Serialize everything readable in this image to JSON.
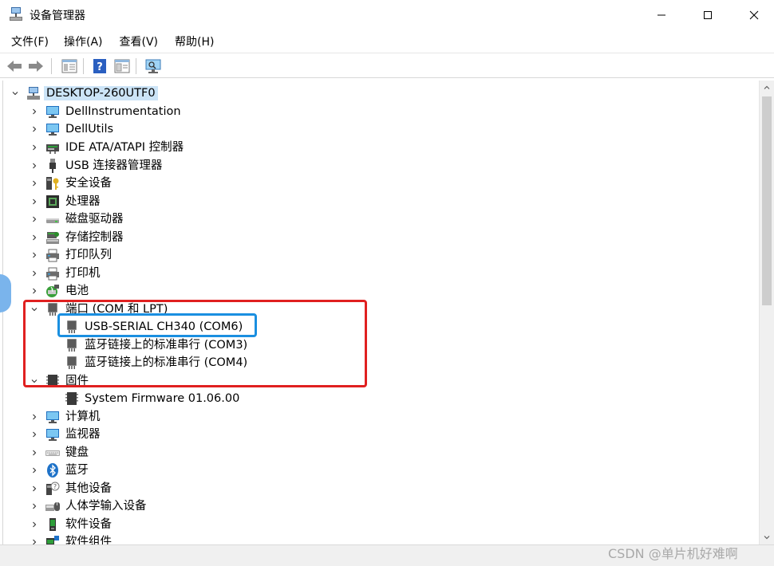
{
  "window": {
    "title": "设备管理器",
    "controls": {
      "minimize": "–",
      "maximize": "□",
      "close": "✕"
    }
  },
  "menu": {
    "items": [
      {
        "label": "文件(F)"
      },
      {
        "label": "操作(A)"
      },
      {
        "label": "查看(V)"
      },
      {
        "label": "帮助(H)"
      }
    ]
  },
  "toolbar": {
    "buttons": [
      "back-arrow-icon",
      "forward-arrow-icon",
      "properties-icon",
      "help-icon",
      "view-panel-icon",
      "monitor-scan-icon"
    ]
  },
  "tree": {
    "root": {
      "label": "DESKTOP-260UTF0"
    },
    "categories": [
      {
        "label": "DellInstrumentation",
        "icon": "monitor-icon",
        "expanded": false
      },
      {
        "label": "DellUtils",
        "icon": "monitor-icon",
        "expanded": false
      },
      {
        "label": "IDE ATA/ATAPI 控制器",
        "icon": "ide-controller-icon",
        "expanded": false
      },
      {
        "label": "USB 连接器管理器",
        "icon": "usb-plug-icon",
        "expanded": false
      },
      {
        "label": "安全设备",
        "icon": "security-key-icon",
        "expanded": false
      },
      {
        "label": "处理器",
        "icon": "processor-chip-icon",
        "expanded": false
      },
      {
        "label": "磁盘驱动器",
        "icon": "disk-drive-icon",
        "expanded": false
      },
      {
        "label": "存储控制器",
        "icon": "storage-controller-icon",
        "expanded": false
      },
      {
        "label": "打印队列",
        "icon": "printer-icon",
        "expanded": false
      },
      {
        "label": "打印机",
        "icon": "printer-icon",
        "expanded": false
      },
      {
        "label": "电池",
        "icon": "battery-icon",
        "expanded": false
      },
      {
        "label": "端口 (COM 和 LPT)",
        "icon": "port-connector-icon",
        "expanded": true,
        "children": [
          {
            "label": "USB-SERIAL CH340 (COM6)",
            "icon": "port-connector-icon"
          },
          {
            "label": "蓝牙链接上的标准串行 (COM3)",
            "icon": "port-connector-icon"
          },
          {
            "label": "蓝牙链接上的标准串行 (COM4)",
            "icon": "port-connector-icon"
          }
        ]
      },
      {
        "label": "固件",
        "icon": "firmware-chip-icon",
        "expanded": true,
        "children": [
          {
            "label": "System Firmware 01.06.00",
            "icon": "firmware-chip-icon"
          }
        ]
      },
      {
        "label": "计算机",
        "icon": "monitor-icon",
        "expanded": false
      },
      {
        "label": "监视器",
        "icon": "monitor-icon",
        "expanded": false
      },
      {
        "label": "键盘",
        "icon": "keyboard-icon",
        "expanded": false
      },
      {
        "label": "蓝牙",
        "icon": "bluetooth-icon",
        "expanded": false
      },
      {
        "label": "其他设备",
        "icon": "unknown-device-icon",
        "expanded": false
      },
      {
        "label": "人体学输入设备",
        "icon": "hid-device-icon",
        "expanded": false
      },
      {
        "label": "软件设备",
        "icon": "software-device-icon",
        "expanded": false
      },
      {
        "label": "软件组件",
        "icon": "software-component-icon",
        "expanded": false
      }
    ]
  },
  "watermark": "CSDN @单片机好难啊",
  "colors": {
    "selection": "#cce4f7",
    "highlight_red": "#e02020",
    "highlight_blue": "#1a8fe0"
  }
}
